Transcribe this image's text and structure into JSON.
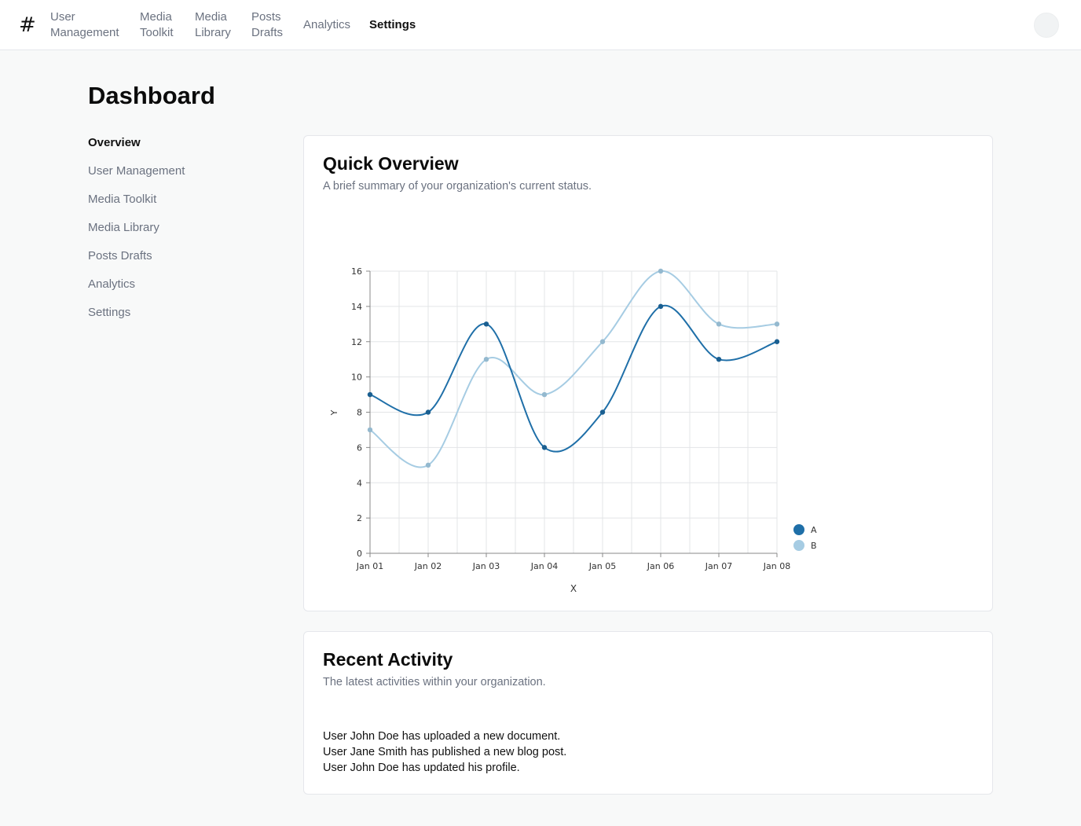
{
  "nav": {
    "items": [
      {
        "label": "User Management"
      },
      {
        "label": "Media Toolkit"
      },
      {
        "label": "Media Library"
      },
      {
        "label": "Posts Drafts"
      },
      {
        "label": "Analytics"
      },
      {
        "label": "Settings"
      }
    ]
  },
  "page": {
    "title": "Dashboard"
  },
  "sidebar": {
    "items": [
      {
        "label": "Overview"
      },
      {
        "label": "User Management"
      },
      {
        "label": "Media Toolkit"
      },
      {
        "label": "Media Library"
      },
      {
        "label": "Posts Drafts"
      },
      {
        "label": "Analytics"
      },
      {
        "label": "Settings"
      }
    ]
  },
  "overview": {
    "title": "Quick Overview",
    "subtitle": "A brief summary of your organization's current status."
  },
  "activity": {
    "title": "Recent Activity",
    "subtitle": "The latest activities within your organization.",
    "items": [
      "User John Doe has uploaded a new document.",
      "User Jane Smith has published a new blog post.",
      "User John Doe has updated his profile."
    ]
  },
  "colors": {
    "series_a": "#1f6fa8",
    "series_b": "#a6cce3"
  },
  "chart_data": {
    "type": "line",
    "xlabel": "X",
    "ylabel": "Y",
    "categories": [
      "Jan 01",
      "Jan 02",
      "Jan 03",
      "Jan 04",
      "Jan 05",
      "Jan 06",
      "Jan 07",
      "Jan 08"
    ],
    "ylim": [
      0,
      16
    ],
    "yticks": [
      0,
      2,
      4,
      6,
      8,
      10,
      12,
      14,
      16
    ],
    "grid": true,
    "legend": "bottom-right",
    "series": [
      {
        "name": "A",
        "values": [
          9,
          8,
          13,
          6,
          8,
          14,
          11,
          12
        ]
      },
      {
        "name": "B",
        "values": [
          7,
          5,
          11,
          9,
          12,
          16,
          13,
          13
        ]
      }
    ]
  }
}
